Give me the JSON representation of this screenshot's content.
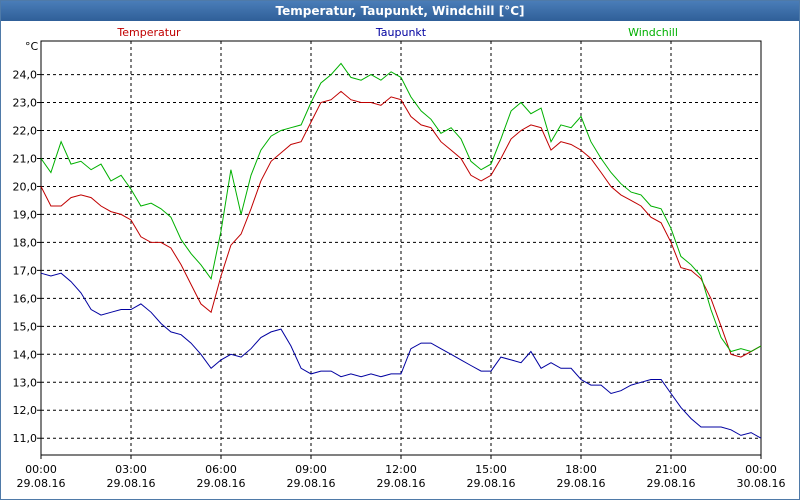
{
  "window": {
    "title": "Temperatur, Taupunkt, Windchill [°C]"
  },
  "chart_data": {
    "type": "line",
    "title": "Temperatur, Taupunkt, Windchill [°C]",
    "ylabel": "°C",
    "xlabel": "",
    "ylim": [
      10.4,
      25.2
    ],
    "xlim": [
      0,
      24
    ],
    "grid": true,
    "legend": "top",
    "yticks": [
      "11,0",
      "12,0",
      "13,0",
      "14,0",
      "15,0",
      "16,0",
      "17,0",
      "18,0",
      "19,0",
      "20,0",
      "21,0",
      "22,0",
      "23,0",
      "24,0"
    ],
    "xticks": [
      {
        "time": "00:00",
        "date": "29.08.16"
      },
      {
        "time": "03:00",
        "date": "29.08.16"
      },
      {
        "time": "06:00",
        "date": "29.08.16"
      },
      {
        "time": "09:00",
        "date": "29.08.16"
      },
      {
        "time": "12:00",
        "date": "29.08.16"
      },
      {
        "time": "15:00",
        "date": "29.08.16"
      },
      {
        "time": "18:00",
        "date": "29.08.16"
      },
      {
        "time": "21:00",
        "date": "29.08.16"
      },
      {
        "time": "00:00",
        "date": "30.08.16"
      }
    ],
    "series": [
      {
        "name": "Temperatur",
        "color": "#c00000",
        "x": [
          0,
          0.33,
          0.67,
          1,
          1.33,
          1.67,
          2,
          2.33,
          2.67,
          3,
          3.33,
          3.67,
          4,
          4.33,
          4.67,
          5,
          5.33,
          5.67,
          6,
          6.33,
          6.67,
          7,
          7.33,
          7.67,
          8,
          8.33,
          8.67,
          9,
          9.33,
          9.67,
          10,
          10.33,
          10.67,
          11,
          11.33,
          11.67,
          12,
          12.33,
          12.67,
          13,
          13.33,
          13.67,
          14,
          14.33,
          14.67,
          15,
          15.33,
          15.67,
          16,
          16.33,
          16.67,
          17,
          17.33,
          17.67,
          18,
          18.33,
          18.67,
          19,
          19.33,
          19.67,
          20,
          20.33,
          20.67,
          21,
          21.33,
          21.67,
          22,
          22.33,
          22.67,
          23,
          23.33,
          23.67,
          24
        ],
        "y": [
          20.0,
          19.3,
          19.3,
          19.6,
          19.7,
          19.6,
          19.3,
          19.1,
          19.0,
          18.8,
          18.2,
          18.0,
          18.0,
          17.8,
          17.2,
          16.5,
          15.8,
          15.5,
          16.8,
          17.9,
          18.3,
          19.2,
          20.2,
          20.9,
          21.2,
          21.5,
          21.6,
          22.3,
          23.0,
          23.1,
          23.4,
          23.1,
          23.0,
          23.0,
          22.9,
          23.2,
          23.1,
          22.5,
          22.2,
          22.1,
          21.6,
          21.3,
          21.0,
          20.4,
          20.2,
          20.4,
          21.0,
          21.7,
          22.0,
          22.2,
          22.1,
          21.3,
          21.6,
          21.5,
          21.3,
          21.0,
          20.5,
          20.0,
          19.7,
          19.5,
          19.3,
          18.9,
          18.7,
          18.0,
          17.1,
          17.0,
          16.7,
          16.0,
          15.0,
          14.0,
          13.9,
          14.1,
          14.3
        ]
      },
      {
        "name": "Taupunkt",
        "color": "#0000a0",
        "x": [
          0,
          0.33,
          0.67,
          1,
          1.33,
          1.67,
          2,
          2.33,
          2.67,
          3,
          3.33,
          3.67,
          4,
          4.33,
          4.67,
          5,
          5.33,
          5.67,
          6,
          6.33,
          6.67,
          7,
          7.33,
          7.67,
          8,
          8.33,
          8.67,
          9,
          9.33,
          9.67,
          10,
          10.33,
          10.67,
          11,
          11.33,
          11.67,
          12,
          12.33,
          12.67,
          13,
          13.33,
          13.67,
          14,
          14.33,
          14.67,
          15,
          15.33,
          15.67,
          16,
          16.33,
          16.67,
          17,
          17.33,
          17.67,
          18,
          18.33,
          18.67,
          19,
          19.33,
          19.67,
          20,
          20.33,
          20.67,
          21,
          21.33,
          21.67,
          22,
          22.33,
          22.67,
          23,
          23.33,
          23.67,
          24
        ],
        "y": [
          16.9,
          16.8,
          16.9,
          16.6,
          16.2,
          15.6,
          15.4,
          15.5,
          15.6,
          15.6,
          15.8,
          15.5,
          15.1,
          14.8,
          14.7,
          14.4,
          14.0,
          13.5,
          13.8,
          14.0,
          13.9,
          14.2,
          14.6,
          14.8,
          14.9,
          14.3,
          13.5,
          13.3,
          13.4,
          13.4,
          13.2,
          13.3,
          13.2,
          13.3,
          13.2,
          13.3,
          13.3,
          14.2,
          14.4,
          14.4,
          14.2,
          14.0,
          13.8,
          13.6,
          13.4,
          13.4,
          13.9,
          13.8,
          13.7,
          14.1,
          13.5,
          13.7,
          13.5,
          13.5,
          13.1,
          12.9,
          12.9,
          12.6,
          12.7,
          12.9,
          13.0,
          13.1,
          13.1,
          12.6,
          12.1,
          11.7,
          11.4,
          11.4,
          11.4,
          11.3,
          11.1,
          11.2,
          11.0
        ]
      },
      {
        "name": "Windchill",
        "color": "#00b000",
        "x": [
          0,
          0.33,
          0.67,
          1,
          1.33,
          1.67,
          2,
          2.33,
          2.67,
          3,
          3.33,
          3.67,
          4,
          4.33,
          4.67,
          5,
          5.33,
          5.67,
          6,
          6.33,
          6.67,
          7,
          7.33,
          7.67,
          8,
          8.33,
          8.67,
          9,
          9.33,
          9.67,
          10,
          10.33,
          10.67,
          11,
          11.33,
          11.67,
          12,
          12.33,
          12.67,
          13,
          13.33,
          13.67,
          14,
          14.33,
          14.67,
          15,
          15.33,
          15.67,
          16,
          16.33,
          16.67,
          17,
          17.33,
          17.67,
          18,
          18.33,
          18.67,
          19,
          19.33,
          19.67,
          20,
          20.33,
          20.67,
          21,
          21.33,
          21.67,
          22,
          22.33,
          22.67,
          23,
          23.33,
          23.67,
          24
        ],
        "y": [
          21.0,
          20.5,
          21.6,
          20.8,
          20.9,
          20.6,
          20.8,
          20.2,
          20.4,
          19.9,
          19.3,
          19.4,
          19.2,
          18.9,
          18.1,
          17.6,
          17.2,
          16.7,
          18.4,
          20.6,
          19.0,
          20.4,
          21.3,
          21.8,
          22.0,
          22.1,
          22.2,
          23.0,
          23.7,
          24.0,
          24.4,
          23.9,
          23.8,
          24.0,
          23.8,
          24.1,
          23.9,
          23.2,
          22.7,
          22.4,
          21.9,
          22.1,
          21.7,
          20.9,
          20.6,
          20.8,
          21.7,
          22.7,
          23.0,
          22.6,
          22.8,
          21.6,
          22.2,
          22.1,
          22.5,
          21.6,
          21.0,
          20.5,
          20.1,
          19.8,
          19.7,
          19.3,
          19.2,
          18.5,
          17.5,
          17.2,
          16.8,
          15.6,
          14.6,
          14.1,
          14.2,
          14.1,
          14.3
        ]
      }
    ]
  }
}
